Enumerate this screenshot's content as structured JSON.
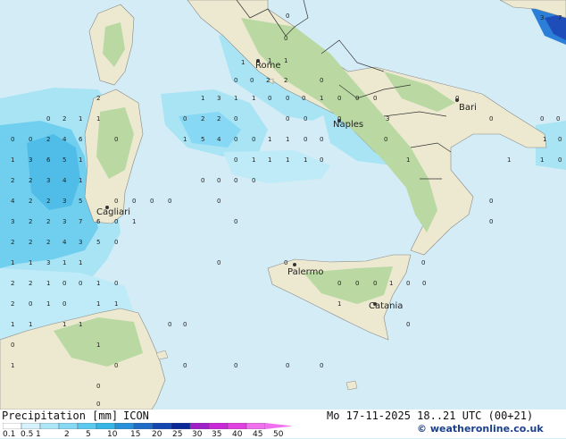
{
  "map": {
    "cities": [
      {
        "id": "rome",
        "name": "Rome"
      },
      {
        "id": "naples",
        "name": "Naples"
      },
      {
        "id": "bari",
        "name": "Bari"
      },
      {
        "id": "cagliari",
        "name": "Cagliari"
      },
      {
        "id": "palermo",
        "name": "Palermo"
      },
      {
        "id": "catania",
        "name": "Catania"
      }
    ],
    "sample_values": [
      "0",
      "1",
      "2",
      "3",
      "4",
      "5",
      "6",
      "7"
    ],
    "colors": {
      "sea": "#d4ecf6",
      "land": "#ece9d0",
      "land_green": "#b9d8a2",
      "precip_light": "#a8e4f4",
      "precip_mid": "#70cfee",
      "precip_heavy": "#3fb2e8"
    }
  },
  "footer": {
    "title": "Precipitation [mm]",
    "model": "ICON",
    "datetime": "Mo 17-11-2025 18..21 UTC (00+21)",
    "credit": "© weatheronline.co.uk",
    "legend_labels": [
      "0.1",
      "0.5",
      "1",
      "2",
      "5",
      "10",
      "15",
      "20",
      "25",
      "30",
      "35",
      "40",
      "45",
      "50"
    ],
    "legend_colors": [
      "#ffffff",
      "#d6f2fc",
      "#aee6f8",
      "#86d8f4",
      "#5ec9ee",
      "#36b6e6",
      "#2890d8",
      "#1e6cc8",
      "#1448b0",
      "#0a2898",
      "#a020c8",
      "#c828d8",
      "#e040e0",
      "#f070f0"
    ]
  }
}
